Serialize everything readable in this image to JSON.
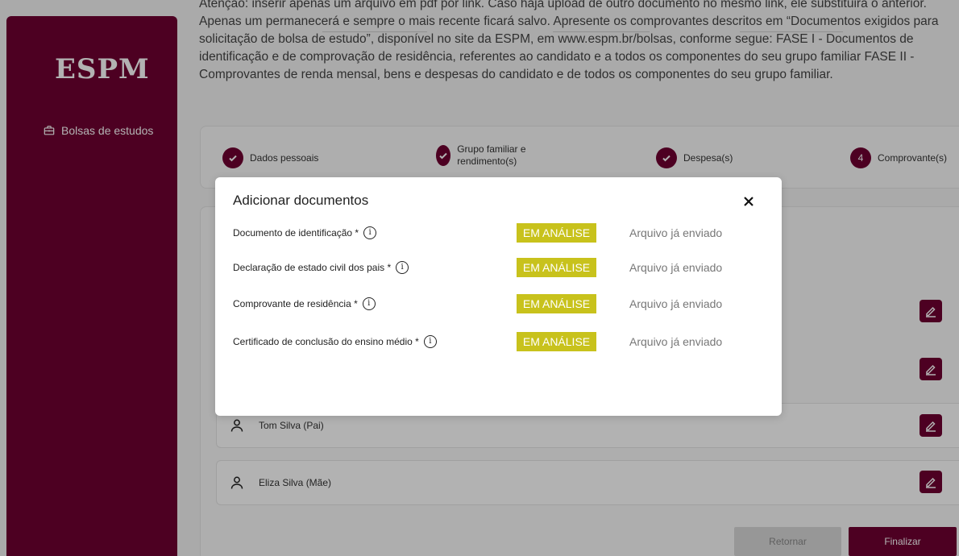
{
  "sidebar": {
    "logo": "ESPM",
    "items": [
      {
        "label": "Bolsas de estudos",
        "icon": "briefcase-icon"
      }
    ]
  },
  "notice": {
    "text": "Atenção: inserir apenas um arquivo em pdf por link. Caso haja upload de outro documento no mesmo link, ele substituirá o anterior. Apenas um permanecerá e sempre o mais recente ficará salvo. Apresente os comprovantes descritos em “Documentos exigidos para solicitação de bolsa de estudo”, disponível no site da ESPM, em www.espm.br/bolsas, conforme segue: FASE I - Documentos de identificação e de comprovação de residência, referentes ao candidato e a todos os componentes do seu grupo familiar FASE II - Comprovantes de renda mensal, bens e despesas do candidato e de todos os componentes do seu grupo familiar."
  },
  "stepper": {
    "steps": [
      {
        "label": "Dados pessoais",
        "state": "done"
      },
      {
        "label": "Grupo familiar e rendimento(s)",
        "state": "done"
      },
      {
        "label": "Despesa(s)",
        "state": "done"
      },
      {
        "label": "Comprovante(s)",
        "state": "current",
        "number": "4"
      }
    ]
  },
  "members": [
    {
      "name": "Tom Silva (Pai)"
    },
    {
      "name": "Eliza Silva (Mãe)"
    }
  ],
  "footer": {
    "back_label": "Retornar",
    "finish_label": "Finalizar"
  },
  "modal": {
    "title": "Adicionar documentos",
    "close_icon": "close-icon",
    "documents": [
      {
        "label": "Documento de identificação *",
        "status": "EM ANÁLISE",
        "file_status": "Arquivo já enviado"
      },
      {
        "label": "Declaração de estado civil dos pais *",
        "status": "EM ANÁLISE",
        "file_status": "Arquivo já enviado"
      },
      {
        "label": "Comprovante de residência *",
        "status": "EM ANÁLISE",
        "file_status": "Arquivo já enviado"
      },
      {
        "label": "Certificado de conclusão do ensino médio *",
        "status": "EM ANÁLISE",
        "file_status": "Arquivo já enviado"
      }
    ]
  },
  "colors": {
    "brand": "#6f0031",
    "badge": "#c8c21c"
  }
}
